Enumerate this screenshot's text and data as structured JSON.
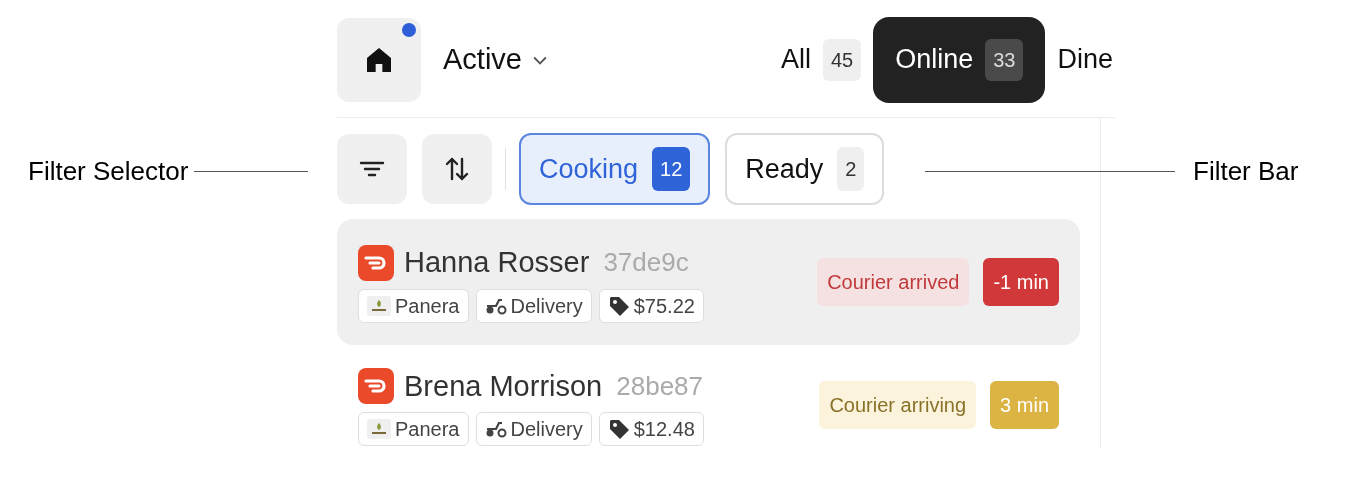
{
  "annotations": {
    "left": "Filter Selector",
    "right": "Filter Bar"
  },
  "header": {
    "notification": true,
    "view": "Active",
    "tabs": [
      {
        "label": "All",
        "count": "45",
        "selected": false
      },
      {
        "label": "Online",
        "count": "33",
        "selected": true
      },
      {
        "label": "Dine",
        "selected": false
      }
    ]
  },
  "filters": [
    {
      "label": "Cooking",
      "count": "12",
      "selected": true
    },
    {
      "label": "Ready",
      "count": "2",
      "selected": false
    }
  ],
  "orders": [
    {
      "name": "Hanna Rosser",
      "code": "37de9c",
      "store": "Panera",
      "method": "Delivery",
      "total": "$75.22",
      "status": "Courier arrived",
      "time": "-1 min",
      "kind": "alert",
      "selected": true
    },
    {
      "name": "Brena Morrison",
      "code": "28be87",
      "store": "Panera",
      "method": "Delivery",
      "total": "$12.48",
      "status": "Courier arriving",
      "time": "3 min",
      "kind": "warning",
      "selected": false
    }
  ]
}
